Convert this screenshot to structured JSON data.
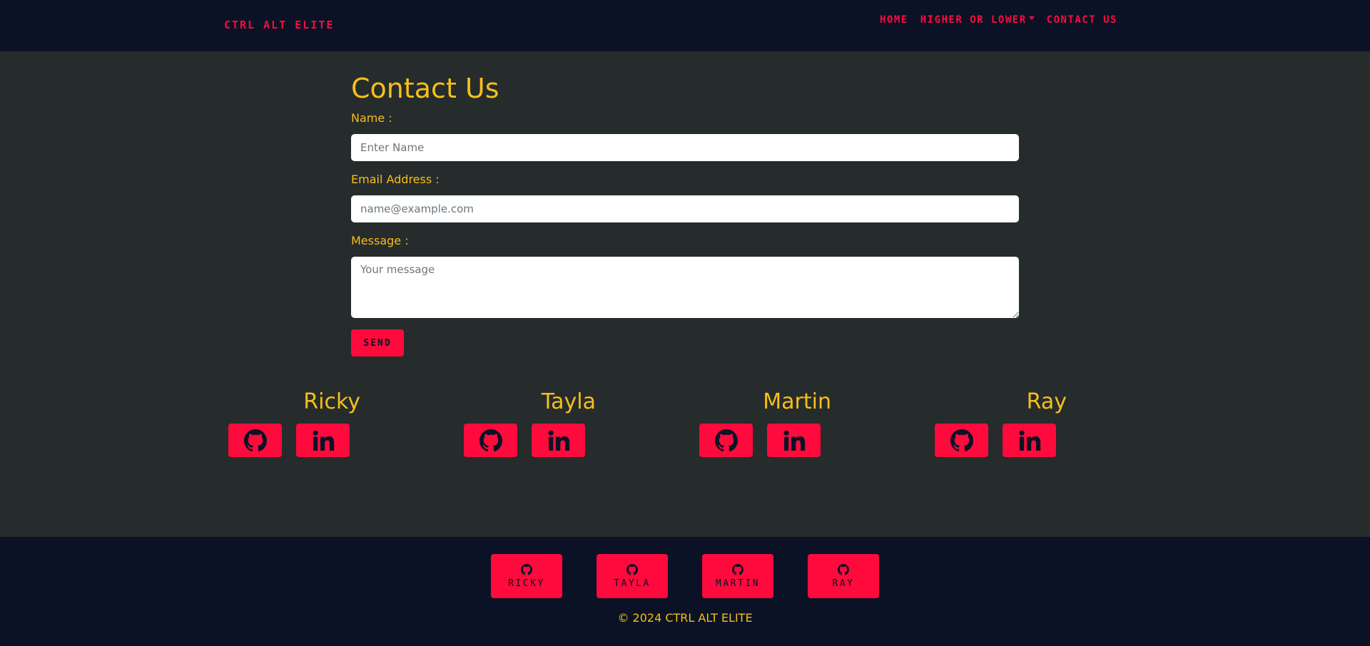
{
  "nav": {
    "brand": "CTRL ALT ELITE",
    "links": [
      {
        "label": "HOME"
      },
      {
        "label": "HIGHER OR LOWER",
        "has_dropdown": true
      },
      {
        "label": "CONTACT US"
      }
    ]
  },
  "contact": {
    "title": "Contact Us",
    "name_label": "Name :",
    "name_placeholder": "Enter Name",
    "email_label": "Email Address :",
    "email_placeholder": "name@example.com",
    "message_label": "Message :",
    "message_placeholder": "Your message",
    "send_label": "SEND"
  },
  "team": [
    {
      "name": "Ricky",
      "icons": [
        "github-icon",
        "linkedin-icon"
      ]
    },
    {
      "name": "Tayla",
      "icons": [
        "github-icon",
        "linkedin-icon"
      ]
    },
    {
      "name": "Martin",
      "icons": [
        "github-icon",
        "linkedin-icon"
      ]
    },
    {
      "name": "Ray",
      "icons": [
        "github-icon",
        "linkedin-icon"
      ]
    }
  ],
  "footer": {
    "buttons": [
      {
        "label": "RICKY",
        "icon": "github-icon"
      },
      {
        "label": "TAYLA",
        "icon": "github-icon"
      },
      {
        "label": "MARTIN",
        "icon": "github-icon"
      },
      {
        "label": "RAY",
        "icon": "github-icon"
      }
    ],
    "copyright": "© 2024 CTRL ALT ELITE"
  },
  "colors": {
    "accent": "#ff0a3c",
    "heading": "#f6bf18",
    "nav_bg": "#0b1226",
    "page_bg": "#262b2c"
  }
}
